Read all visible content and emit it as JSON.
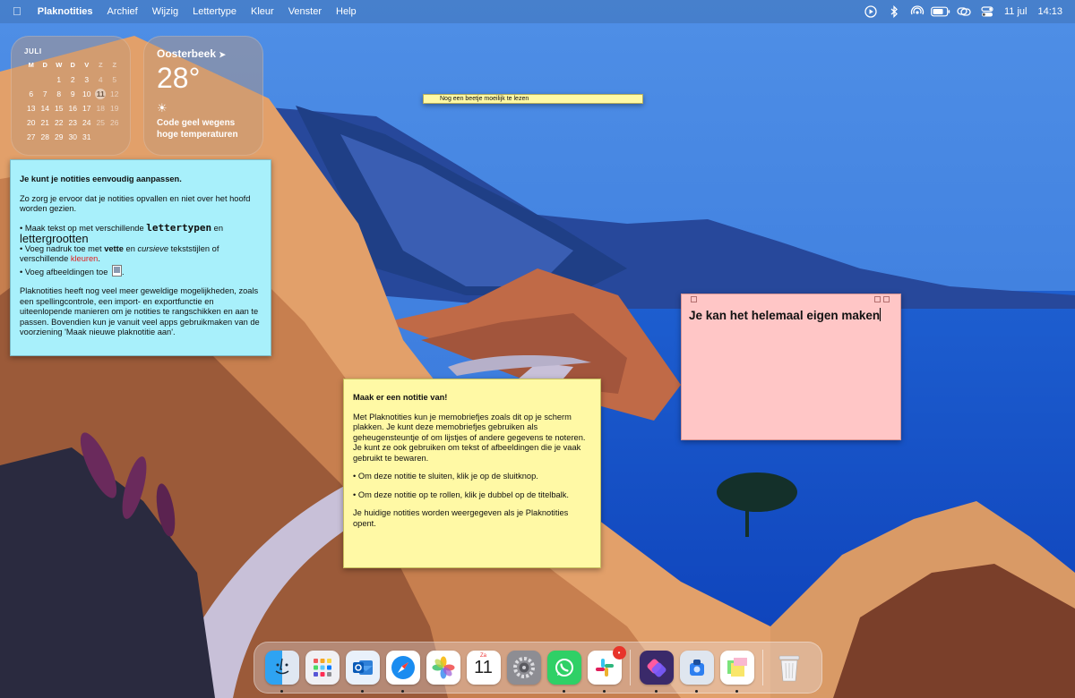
{
  "menubar": {
    "app_name": "Plaknotities",
    "menus": [
      "Archief",
      "Wijzig",
      "Lettertype",
      "Kleur",
      "Venster",
      "Help"
    ],
    "clock_date": "11 jul",
    "clock_time": "14:13",
    "status_icons": [
      "play-icon",
      "bluetooth-icon",
      "airdrop-icon",
      "battery-icon",
      "screen-mirroring-icon",
      "control-center-icon"
    ]
  },
  "calendar_widget": {
    "month": "JULI",
    "weekdays": [
      "M",
      "D",
      "W",
      "D",
      "V",
      "Z",
      "Z"
    ],
    "weeks": [
      [
        "",
        "",
        "1",
        "2",
        "3",
        "4",
        "5"
      ],
      [
        "6",
        "7",
        "8",
        "9",
        "10",
        "11",
        "12"
      ],
      [
        "13",
        "14",
        "15",
        "16",
        "17",
        "18",
        "19"
      ],
      [
        "20",
        "21",
        "22",
        "23",
        "24",
        "25",
        "26"
      ],
      [
        "27",
        "28",
        "29",
        "30",
        "31",
        "",
        ""
      ]
    ],
    "today": "11"
  },
  "weather_widget": {
    "location": "Oosterbeek",
    "temperature": "28°",
    "condition_icon": "sun-icon",
    "text": "Code geel wegens hoge temperaturen"
  },
  "note_small": {
    "text": "Nog een beetje moeilijk te lezen",
    "color": "#fff9a5"
  },
  "note_blue": {
    "color": "#a8f0fb",
    "title": "Je kunt je notities eenvoudig aanpassen.",
    "intro": "Zo zorg je ervoor dat je notities opvallen en niet over het hoofd worden gezien.",
    "b1_pre": "• Maak tekst op met verschillende ",
    "b1_fonts": "lettertypen",
    "b1_mid": " en",
    "b1_sizes": "lettergrootten",
    "b2_pre": "• Voeg nadruk toe met ",
    "b2_bold": "vette",
    "b2_mid": " en ",
    "b2_italic": "cursieve",
    "b2_post": " tekststijlen of verschillende ",
    "b2_colors": "kleuren",
    "b2_end": ".",
    "b3": "• Voeg afbeeldingen toe",
    "b3_end": ".",
    "outro": "Plaknotities heeft nog veel meer geweldige mogelijkheden, zoals een spellingcontrole, een import- en exportfunctie en uiteenlopende manieren om je notities te rangschikken en aan te passen. Bovendien kun je vanuit veel apps gebruikmaken van de voorziening 'Maak nieuwe plaknotitie aan'."
  },
  "note_yellow": {
    "color": "#fff9a5",
    "title": "Maak er een notitie van!",
    "p1": "Met Plaknotities kun je memobriefjes zoals dit op je scherm plakken. Je kunt deze memobriefjes gebruiken als geheugensteuntje of om lijstjes of andere gegevens te noteren. Je kunt ze ook gebruiken om tekst of afbeeldingen die je vaak gebruikt te bewaren.",
    "p2": "• Om deze notitie te sluiten, klik je op de sluitknop.",
    "p3": "• Om deze notitie op te rollen, klik je dubbel op de titelbalk.",
    "p4": "Je huidige notities worden weergegeven als je Plaknotities opent."
  },
  "note_pink": {
    "color": "#ffc6c6",
    "text": "Je kan het helemaal eigen maken"
  },
  "dock": {
    "apps": [
      {
        "name": "Finder",
        "icon": "finder-icon",
        "running": true
      },
      {
        "name": "Launchpad",
        "icon": "launchpad-icon",
        "running": false
      },
      {
        "name": "Outlook",
        "icon": "outlook-icon",
        "running": true
      },
      {
        "name": "Safari",
        "icon": "safari-icon",
        "running": true
      },
      {
        "name": "Foto's",
        "icon": "photos-icon",
        "running": false
      },
      {
        "name": "Agenda",
        "icon": "calendar-icon",
        "running": false
      },
      {
        "name": "Systeeminstellingen",
        "icon": "settings-icon",
        "running": false
      },
      {
        "name": "WhatsApp",
        "icon": "whatsapp-icon",
        "running": true
      },
      {
        "name": "Slack",
        "icon": "slack-icon",
        "running": true,
        "badge": "•"
      },
      {
        "name": "Opdrachten",
        "icon": "shortcuts-icon",
        "running": true
      },
      {
        "name": "Schermafbeelding",
        "icon": "screenshot-icon",
        "running": true
      },
      {
        "name": "Plaknotities",
        "icon": "stickies-icon",
        "running": true
      },
      {
        "name": "Prullenmand",
        "icon": "trash-icon",
        "running": false
      }
    ],
    "calendar_icon_month": "Za",
    "calendar_icon_day": "11"
  }
}
